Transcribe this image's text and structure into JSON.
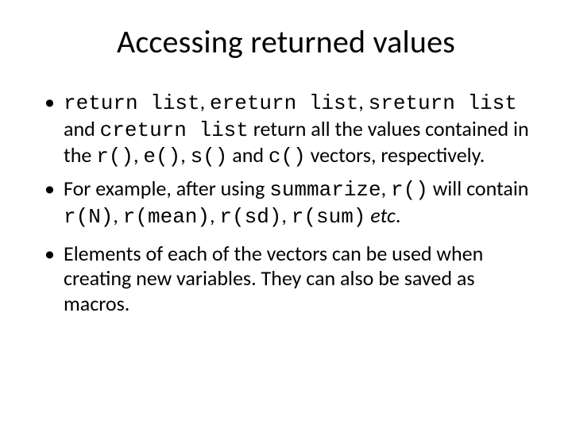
{
  "title": "Accessing returned values",
  "bullets": [
    {
      "p0": "return list",
      "p1": ", ",
      "p2": "ereturn list",
      "p3": ", ",
      "p4": "sreturn list",
      "p5": " and ",
      "p6": "creturn list",
      "p7": " return all the values contained in the ",
      "p8": "r()",
      "p9": ", ",
      "p10": "e()",
      "p11": ", ",
      "p12": "s()",
      "p13": " and ",
      "p14": "c()",
      "p15": " vectors, respectively."
    },
    {
      "p0": "For example, after using ",
      "p1": "summarize",
      "p2": ", ",
      "p3": "r()",
      "p4": " will contain ",
      "p5": "r(N)",
      "p6": ", ",
      "p7": "r(mean)",
      "p8": ", ",
      "p9": "r(sd)",
      "p10": ", ",
      "p11": "r(sum)",
      "p12": " ",
      "p13": "etc",
      "p14": "."
    },
    {
      "p0": "Elements of each of the vectors can be used when creating new variables. They can also be saved as macros."
    }
  ]
}
